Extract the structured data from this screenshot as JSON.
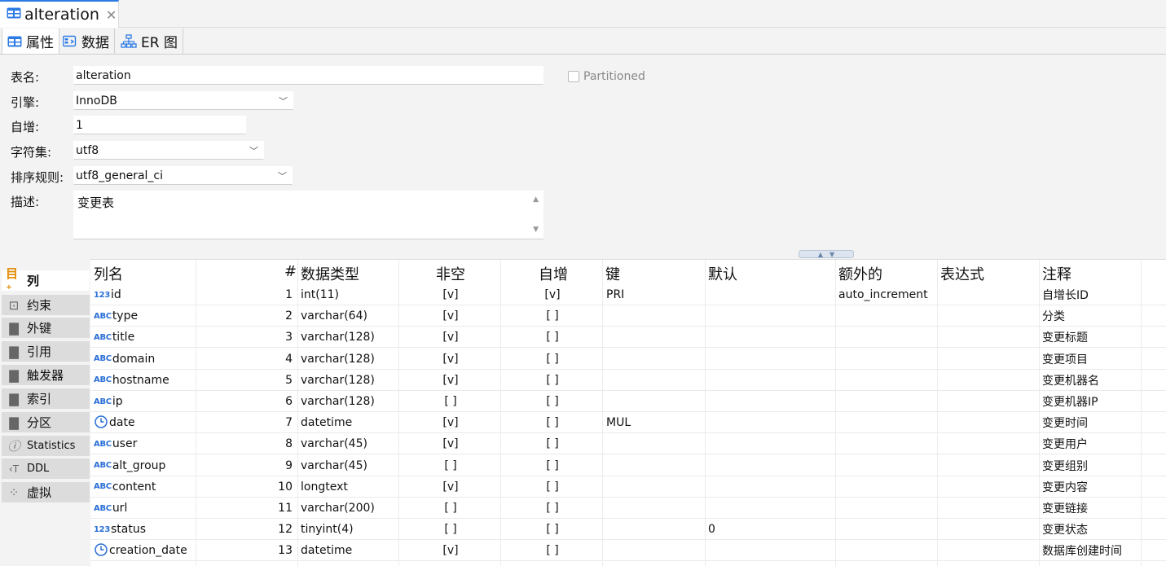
{
  "editor_tab": {
    "title": "alteration",
    "close": "✕"
  },
  "subtabs": [
    {
      "label": "属性",
      "icon": "table-icon"
    },
    {
      "label": "数据",
      "icon": "data-grid-icon"
    },
    {
      "label": "ER 图",
      "icon": "er-diagram-icon"
    }
  ],
  "form": {
    "table_name_label": "表名:",
    "table_name": "alteration",
    "engine_label": "引擎:",
    "engine": "InnoDB",
    "auto_inc_label": "自增:",
    "auto_inc": "1",
    "charset_label": "字符集:",
    "charset": "utf8",
    "collation_label": "排序规则:",
    "collation": "utf8_general_ci",
    "description_label": "描述:",
    "description": "变更表",
    "partitioned_label": "Partitioned"
  },
  "sidebar": {
    "items": [
      {
        "label": "列",
        "icon": "columns-add-icon"
      },
      {
        "label": "约束",
        "icon": "constraint-icon"
      },
      {
        "label": "外键",
        "icon": "folder-icon"
      },
      {
        "label": "引用",
        "icon": "folder-icon"
      },
      {
        "label": "触发器",
        "icon": "folder-icon"
      },
      {
        "label": "索引",
        "icon": "folder-icon"
      },
      {
        "label": "分区",
        "icon": "folder-icon"
      },
      {
        "label": "Statistics",
        "icon": "info-icon"
      },
      {
        "label": "DDL",
        "icon": "ddl-icon"
      },
      {
        "label": "虚拟",
        "icon": "virtual-icon"
      }
    ]
  },
  "table": {
    "headers": {
      "name": "列名",
      "num": "#",
      "type": "数据类型",
      "notnull": "非空",
      "autoinc": "自增",
      "key": "键",
      "default": "默认",
      "extra": "额外的",
      "expr": "表达式",
      "comment": "注释"
    },
    "rows": [
      {
        "icon": "123",
        "name": "id",
        "num": "1",
        "type": "int(11)",
        "notnull": "[v]",
        "autoinc": "[v]",
        "key": "PRI",
        "default": "",
        "extra": "auto_increment",
        "comment": "自增长ID"
      },
      {
        "icon": "ABC",
        "name": "type",
        "num": "2",
        "type": "varchar(64)",
        "notnull": "[v]",
        "autoinc": "[ ]",
        "key": "",
        "default": "",
        "extra": "",
        "comment": "分类"
      },
      {
        "icon": "ABC",
        "name": "title",
        "num": "3",
        "type": "varchar(128)",
        "notnull": "[v]",
        "autoinc": "[ ]",
        "key": "",
        "default": "",
        "extra": "",
        "comment": "变更标题"
      },
      {
        "icon": "ABC",
        "name": "domain",
        "num": "4",
        "type": "varchar(128)",
        "notnull": "[v]",
        "autoinc": "[ ]",
        "key": "",
        "default": "",
        "extra": "",
        "comment": "变更项目"
      },
      {
        "icon": "ABC",
        "name": "hostname",
        "num": "5",
        "type": "varchar(128)",
        "notnull": "[v]",
        "autoinc": "[ ]",
        "key": "",
        "default": "",
        "extra": "",
        "comment": "变更机器名"
      },
      {
        "icon": "ABC",
        "name": "ip",
        "num": "6",
        "type": "varchar(128)",
        "notnull": "[ ]",
        "autoinc": "[ ]",
        "key": "",
        "default": "",
        "extra": "",
        "comment": "变更机器IP"
      },
      {
        "icon": "clock",
        "name": "date",
        "num": "7",
        "type": "datetime",
        "notnull": "[v]",
        "autoinc": "[ ]",
        "key": "MUL",
        "default": "",
        "extra": "",
        "comment": "变更时间"
      },
      {
        "icon": "ABC",
        "name": "user",
        "num": "8",
        "type": "varchar(45)",
        "notnull": "[v]",
        "autoinc": "[ ]",
        "key": "",
        "default": "",
        "extra": "",
        "comment": "变更用户"
      },
      {
        "icon": "ABC",
        "name": "alt_group",
        "num": "9",
        "type": "varchar(45)",
        "notnull": "[ ]",
        "autoinc": "[ ]",
        "key": "",
        "default": "",
        "extra": "",
        "comment": "变更组别"
      },
      {
        "icon": "ABC",
        "name": "content",
        "num": "10",
        "type": "longtext",
        "notnull": "[v]",
        "autoinc": "[ ]",
        "key": "",
        "default": "",
        "extra": "",
        "comment": "变更内容"
      },
      {
        "icon": "ABC",
        "name": "url",
        "num": "11",
        "type": "varchar(200)",
        "notnull": "[ ]",
        "autoinc": "[ ]",
        "key": "",
        "default": "",
        "extra": "",
        "comment": "变更链接"
      },
      {
        "icon": "123",
        "name": "status",
        "num": "12",
        "type": "tinyint(4)",
        "notnull": "[ ]",
        "autoinc": "[ ]",
        "key": "",
        "default": "0",
        "extra": "",
        "comment": "变更状态"
      },
      {
        "icon": "clock",
        "name": "creation_date",
        "num": "13",
        "type": "datetime",
        "notnull": "[v]",
        "autoinc": "[ ]",
        "key": "",
        "default": "",
        "extra": "",
        "comment": "数据库创建时间"
      }
    ]
  }
}
